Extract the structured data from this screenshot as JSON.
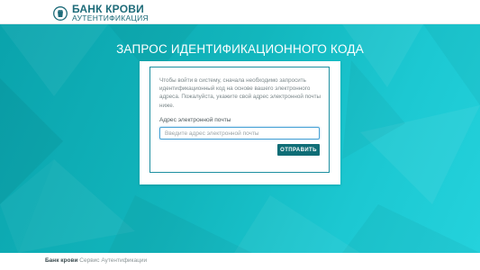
{
  "header": {
    "logo_title": "БАНК КРОВИ",
    "logo_subtitle": "АУТЕНТИФИКАЦИЯ",
    "logo_icon": "blood-drop-shield-icon"
  },
  "main": {
    "title": "ЗАПРОС ИДЕНТИФИКАЦИОННОГО КОДА",
    "intro_text": "Чтобы войти в систему, сначала необходимо запросить идентификационный код на основе вашего электронного адреса. Пожалуйста, укажите свой адрес электронной почты ниже.",
    "email_label": "Адрес электронной почты",
    "email_placeholder": "Введите адрес электронной почты",
    "email_value": "",
    "send_button": "ОТПРАВИТЬ"
  },
  "footer": {
    "brand": "Банк крови",
    "service": "Сервис Аутентификации"
  },
  "colors": {
    "brand": "#1f6c7a",
    "hero_start": "#0aa3ac",
    "hero_end": "#24d2dc",
    "button": "#0f6d76",
    "card_border": "#1d8fa0"
  }
}
